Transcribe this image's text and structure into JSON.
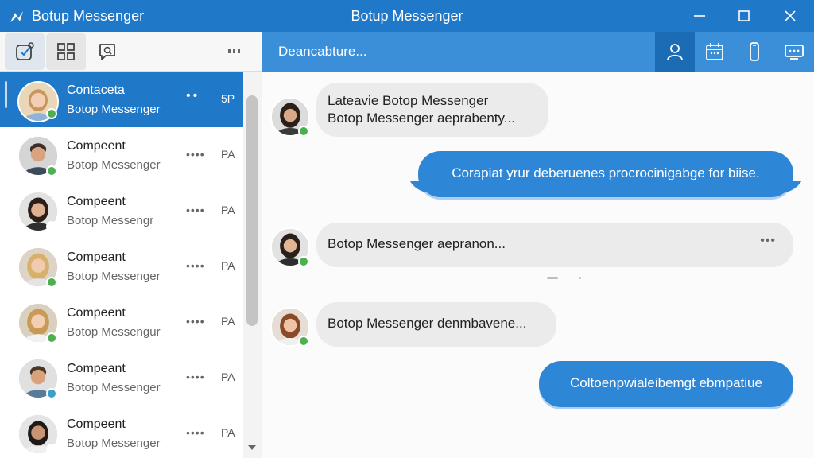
{
  "titlebar": {
    "app_name": "Botup Messenger",
    "window_title": "Botup Messenger"
  },
  "colors": {
    "brand": "#1f78c8",
    "header": "#3b8fd9",
    "bubble_out": "#2d86d6",
    "bubble_in": "#ebebeb",
    "presence": "#4caf50"
  },
  "left_toolbar": {
    "buttons": [
      "new-chat-icon",
      "apps-grid-icon",
      "chat-search-icon"
    ],
    "more": "⠶"
  },
  "contacts": [
    {
      "name": "Contaceta",
      "subtitle": "Botop Messenger",
      "dots": "••",
      "time": "5P",
      "selected": true
    },
    {
      "name": "Compeent",
      "subtitle": "Botop Messenger",
      "dots": "••••",
      "time": "PA"
    },
    {
      "name": "Compeent",
      "subtitle": "Botop Messengr",
      "dots": "••••",
      "time": "PA"
    },
    {
      "name": "Compeant",
      "subtitle": "Botop Messenger",
      "dots": "••••",
      "time": "PA"
    },
    {
      "name": "Compeent",
      "subtitle": "Botop Messengur",
      "dots": "••••",
      "time": "PA"
    },
    {
      "name": "Compeant",
      "subtitle": "Botop Messenger",
      "dots": "••••",
      "time": "PA"
    },
    {
      "name": "Compeent",
      "subtitle": "Botop Messenger",
      "dots": "••••",
      "time": "PA"
    }
  ],
  "chat_header": {
    "title": "Deancabture...",
    "buttons": [
      "person-icon",
      "calendar-icon",
      "phone-icon",
      "screen-share-icon"
    ]
  },
  "messages": {
    "m1_line1": "Lateavie Botop Messenger",
    "m1_line2": "Botop Messenger aeprabenty...",
    "m2": "Corapiat yrur deberuenes procrocinigabge for biise.",
    "m3": "Botop Messenger aepranon...",
    "m3_dots": "•••",
    "m4": "Botop Messenger denmbavene...",
    "m5": "Coltoenpwialeibemgt ebmpatiue"
  }
}
